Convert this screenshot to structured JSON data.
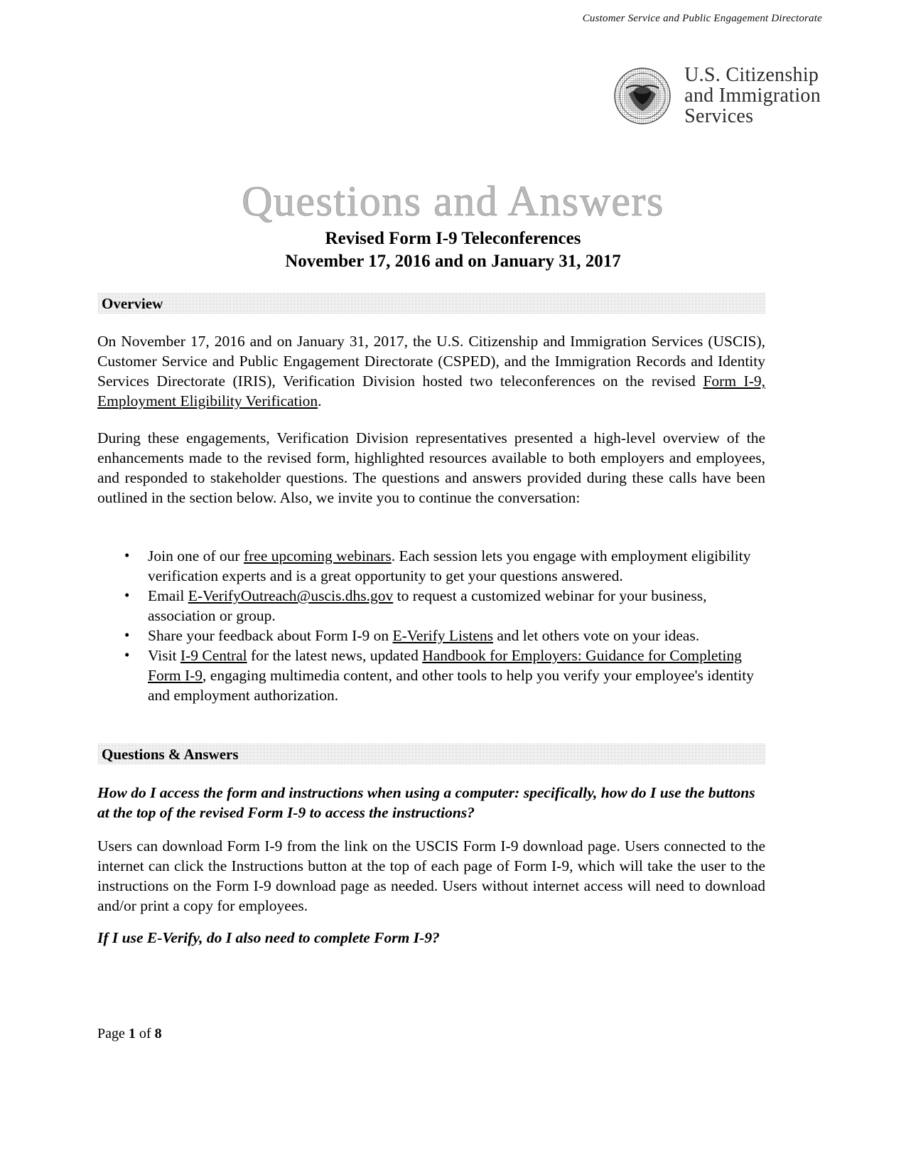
{
  "header": {
    "running_header": "Customer Service and Public Engagement Directorate",
    "logo": {
      "seal_name": "uscis-seal",
      "line1": "U.S. Citizenship",
      "line2": "and Immigration",
      "line3": "Services"
    }
  },
  "title": {
    "main": "Questions and Answers",
    "subtitle_line1": "Revised Form I-9 Teleconferences",
    "subtitle_line2": "November 17, 2016 and on January 31, 2017"
  },
  "sections": {
    "overview": {
      "band_label": "Overview",
      "paragraph_1": {
        "before_link": "On November 17, 2016 and on January 31, 2017, the U.S. Citizenship and Immigration Services (USCIS), Customer Service and Public Engagement Directorate (CSPED), and the Immigration Records and Identity Services Directorate (IRIS), Verification Division hosted two teleconferences on the revised ",
        "link": "Form I-9, Employment Eligibility Verification",
        "after_link": "."
      },
      "paragraph_2": "During these engagements, Verification Division representatives presented a high-level overview of the enhancements made to the revised form, highlighted resources available to both employers and employees, and responded to stakeholder questions. The questions and answers provided during these calls have been outlined in the section below. Also, we invite you to continue the conversation:",
      "bullets": [
        {
          "part1": "Join one of our ",
          "link1": "free upcoming webinars",
          "part2": ". Each session lets you engage with employment eligibility verification experts and is a great opportunity to get your questions answered.",
          "link2": "",
          "part3": ""
        },
        {
          "part1": "Email ",
          "link1": "E-VerifyOutreach@uscis.dhs.gov",
          "part2": " to request a customized webinar for your business, association or group.",
          "link2": "",
          "part3": ""
        },
        {
          "part1": "Share your feedback about Form I-9 on ",
          "link1": "E-Verify Listens",
          "part2": " and let others vote on your ideas.",
          "link2": "",
          "part3": ""
        },
        {
          "part1": "Visit ",
          "link1": "I-9 Central",
          "part2": " for the latest news, updated ",
          "link2": "Handbook for Employers: Guidance for Completing Form I-9",
          "part3": ", engaging multimedia content, and other tools to help you verify your employee's identity and employment authorization."
        }
      ]
    },
    "questions_answers": {
      "band_label": "Questions & Answers",
      "items": [
        {
          "question": "How do I access the form and instructions when using a computer: specifically, how do I use the buttons at the top of the revised Form I-9 to access the instructions?",
          "answer": "Users can download Form I-9 from the link on the USCIS Form I-9 download page. Users connected to the internet can click the Instructions button at the top of each page of Form I-9, which will take the user to the instructions on the Form I-9 download page as needed. Users without internet access will need to download and/or print a copy for employees."
        },
        {
          "question": "If I use E-Verify, do I also need to complete Form I-9?",
          "answer": ""
        }
      ]
    }
  },
  "footer": {
    "prefix": "Page ",
    "current_page": "1",
    "middle": " of ",
    "total_pages": "8"
  }
}
